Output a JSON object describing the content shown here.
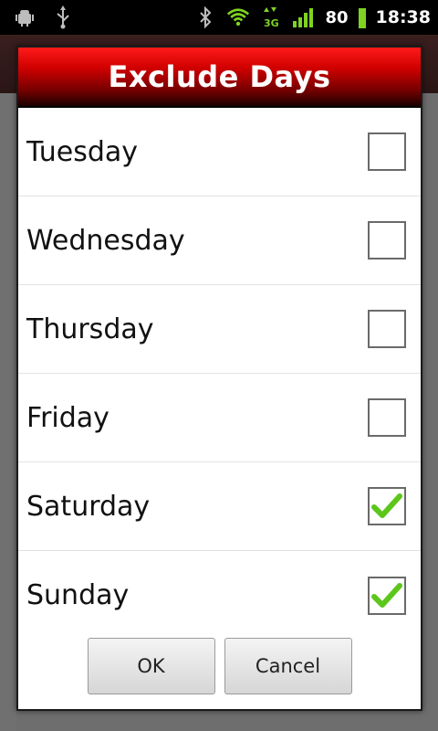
{
  "status_bar": {
    "battery_percent": "80",
    "time": "18:38",
    "network": "3G"
  },
  "dialog": {
    "title": "Exclude Days",
    "days": [
      {
        "label": "Tuesday",
        "checked": false
      },
      {
        "label": "Wednesday",
        "checked": false
      },
      {
        "label": "Thursday",
        "checked": false
      },
      {
        "label": "Friday",
        "checked": false
      },
      {
        "label": "Saturday",
        "checked": true
      },
      {
        "label": "Sunday",
        "checked": true
      }
    ],
    "ok_label": "OK",
    "cancel_label": "Cancel"
  },
  "colors": {
    "header_red": "#d00000",
    "check_green": "#5cc61a"
  }
}
